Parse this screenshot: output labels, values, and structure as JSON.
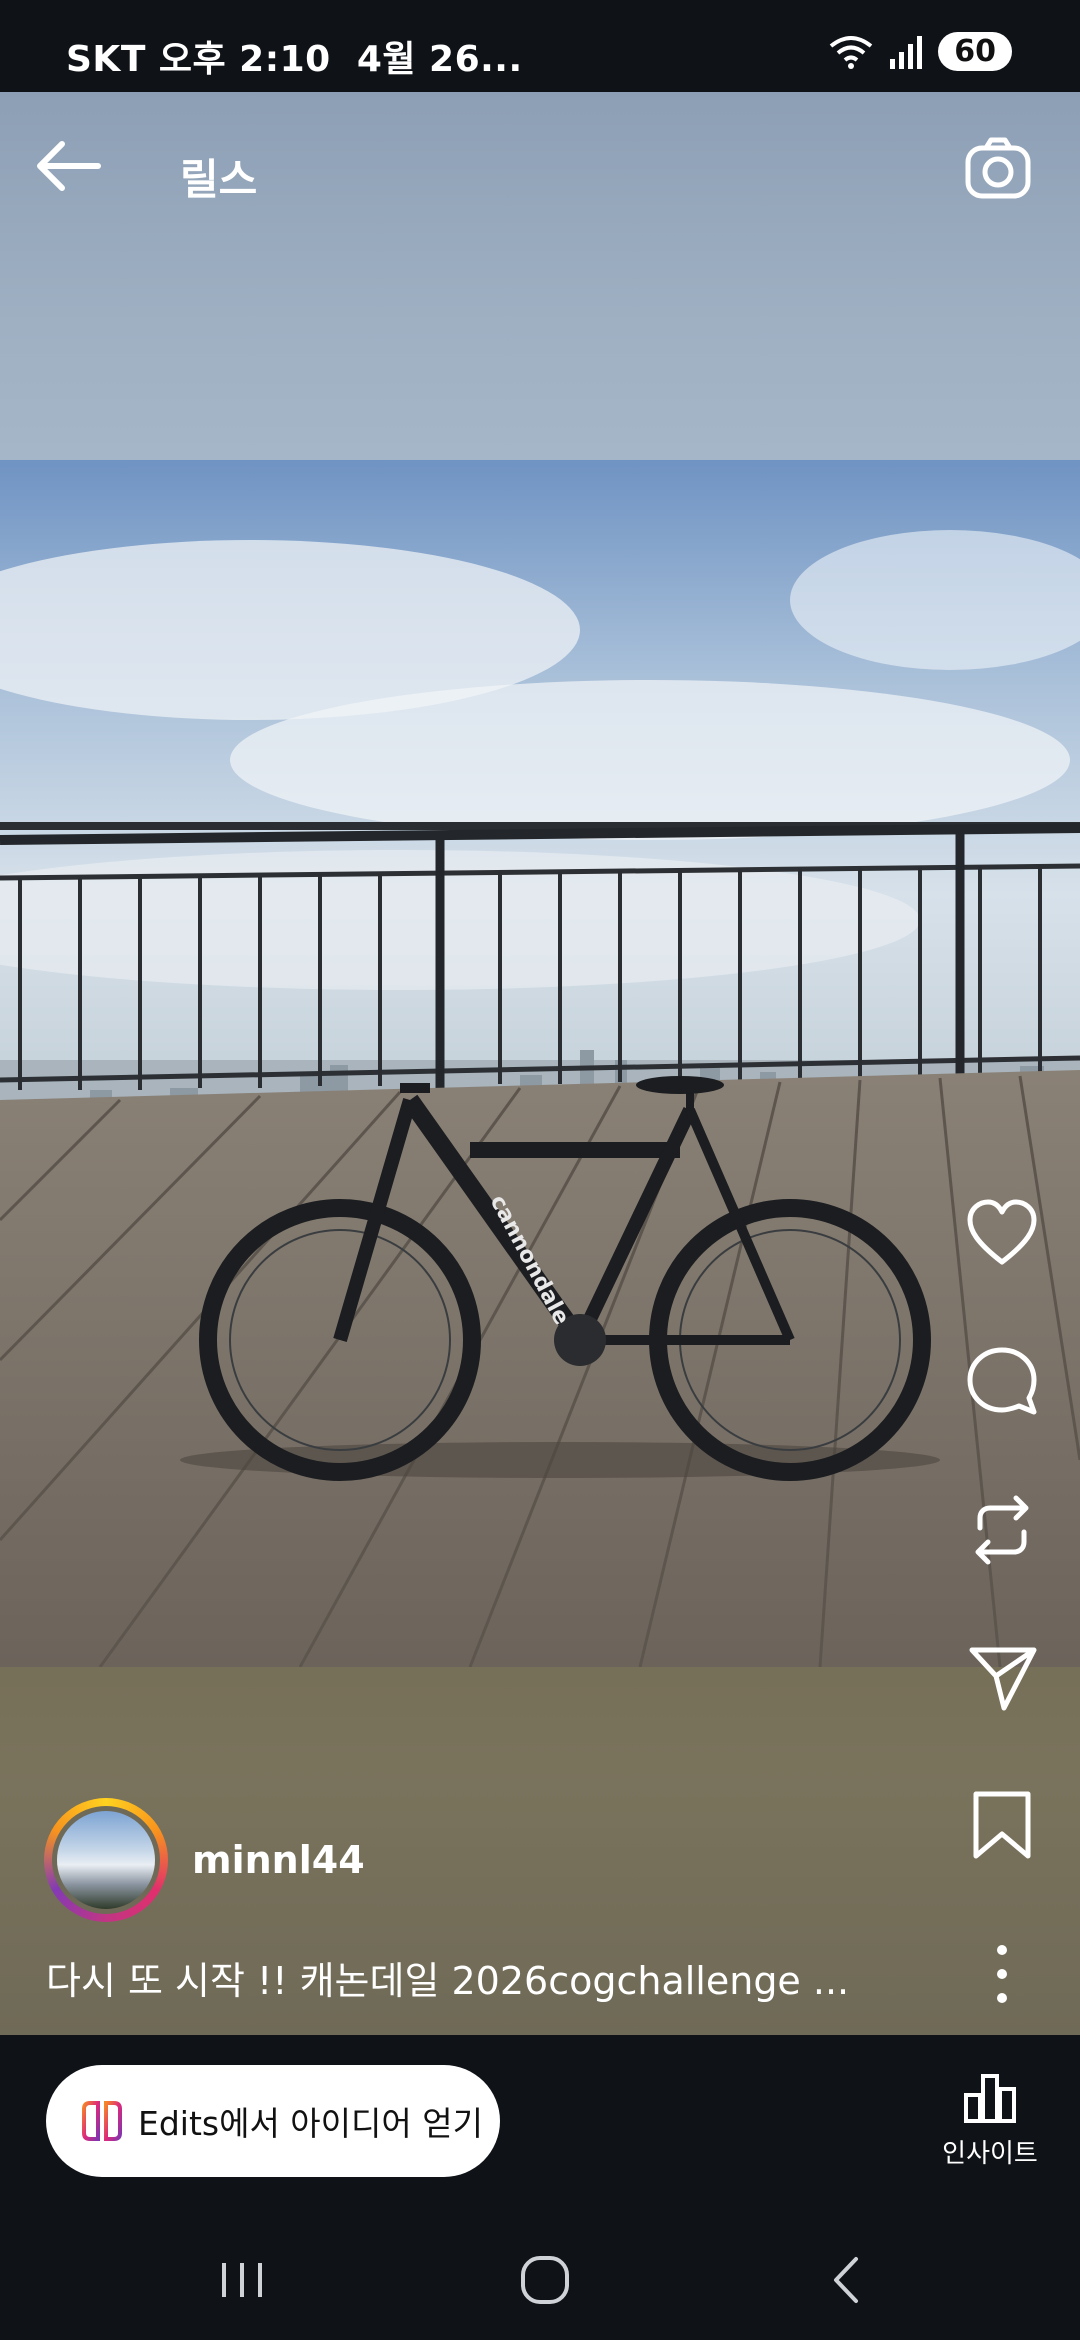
{
  "status_bar": {
    "carrier_time": "SKT 오후 2:10",
    "date": "4월 26...",
    "battery": "60",
    "icons": [
      "wifi-icon",
      "signal-icon",
      "battery-icon"
    ]
  },
  "header": {
    "title": "릴스",
    "back_icon": "arrow-left-icon",
    "camera_icon": "camera-icon"
  },
  "actions": [
    {
      "name": "like",
      "icon": "heart-icon"
    },
    {
      "name": "comment",
      "icon": "comment-icon"
    },
    {
      "name": "remix",
      "icon": "repost-icon"
    },
    {
      "name": "share",
      "icon": "send-icon"
    },
    {
      "name": "save",
      "icon": "bookmark-icon"
    },
    {
      "name": "more",
      "icon": "more-vertical-icon"
    }
  ],
  "post": {
    "username": "minnl44",
    "caption": "다시 또 시작 !! 캐논데일 2026cogchallenge ...",
    "bike_brand_text": "cannondale"
  },
  "bottom": {
    "edits_label": "Edits에서 아이디어 얻기",
    "insights_label": "인사이트"
  },
  "navigation": {
    "recent_icon": "recent-apps-icon",
    "home_icon": "home-icon",
    "back_icon": "back-chevron-icon"
  },
  "colors": {
    "background": "#10141a",
    "button_bg": "#ffffff",
    "story_ring": [
      "#ffd21f",
      "#e1306c",
      "#833ab4"
    ]
  }
}
